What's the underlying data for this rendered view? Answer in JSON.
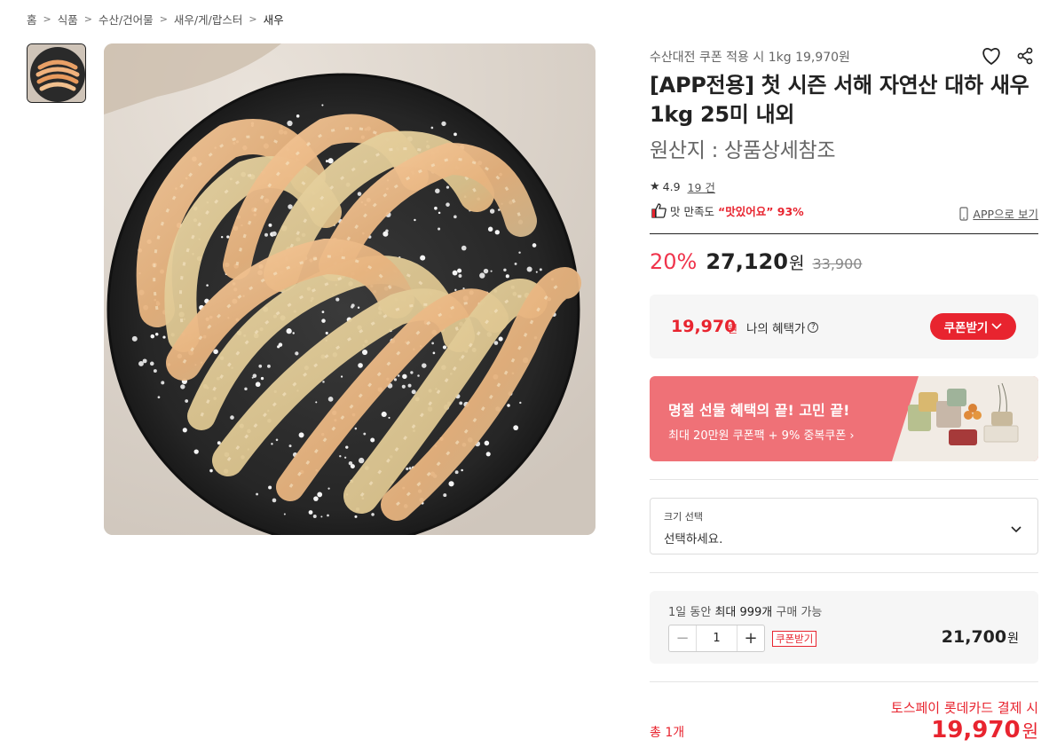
{
  "breadcrumb": [
    "홈",
    "식품",
    "수산/건어물",
    "새우/게/랍스터",
    "새우"
  ],
  "product": {
    "promo_line": "수산대전 쿠폰 적용 시 1kg 19,970원",
    "title": "[APP전용] 첫 시즌 서해 자연산 대하 새우 1kg 25미 내외",
    "origin": "원산지 : 상품상세참조",
    "rating": "4.9",
    "review_count": "19 건",
    "satisfaction_label": "맛 만족도",
    "satisfaction_value": "“맛있어요” 93%",
    "app_view": "APP으로 보기"
  },
  "price": {
    "discount": "20%",
    "sale_price": "27,120",
    "won": "원",
    "original_price": "33,900"
  },
  "benefit": {
    "price": "19,970",
    "won": "원",
    "label": "나의 혜택가",
    "help": "?",
    "coupon_button": "쿠폰받기"
  },
  "banner": {
    "title": "명절 선물 혜택의 끝! 고민 끝!",
    "subtitle": "최대 20만원 쿠폰팩 + 9% 중복쿠폰 ›"
  },
  "option": {
    "label": "크기 선택",
    "value": "선택하세요."
  },
  "quantity": {
    "limit_prefix": "1일 동안",
    "limit_mid": "최대 999개",
    "limit_suffix": "구매 가능",
    "minus": "−",
    "value": "1",
    "plus": "+",
    "coupon": "쿠폰받기",
    "price": "21,700",
    "won": "원"
  },
  "total": {
    "label": "총 1개",
    "pay_text": "토스페이 롯데카드 결제 시",
    "price": "19,970",
    "won": "원"
  },
  "colors": {
    "accent_red": "#e8242f",
    "discount_pink": "#f0344c",
    "banner_pink": "#ef7177"
  },
  "icons": [
    "heart-icon",
    "share-icon",
    "star-icon",
    "thumbs-up-icon",
    "phone-icon",
    "question-icon",
    "chevron-down-icon"
  ]
}
